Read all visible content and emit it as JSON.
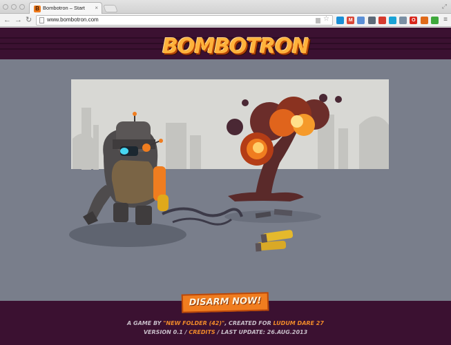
{
  "browser": {
    "tab_favicon_letter": "B",
    "tab_title": "Bombotron – Start",
    "tab_close": "×",
    "url": "www.bombotron.com",
    "nav_back": "←",
    "nav_forward": "→",
    "nav_reload": "↻",
    "star": "☆",
    "menu": "≡",
    "fullscreen": "⤢",
    "extensions": [
      {
        "name": "extension-blue-icon",
        "color": "#1a8fd6",
        "glyph": ""
      },
      {
        "name": "gmail-icon",
        "color": "#d94637",
        "glyph": "M"
      },
      {
        "name": "cloud-extension-icon",
        "color": "#5b8fd6",
        "glyph": ""
      },
      {
        "name": "clipboard-extension-icon",
        "color": "#5d6a78",
        "glyph": ""
      },
      {
        "name": "calendar-extension-icon",
        "color": "#d63a2e",
        "glyph": ""
      },
      {
        "name": "feather-extension-icon",
        "color": "#1aa3d6",
        "glyph": ""
      },
      {
        "name": "link-extension-icon",
        "color": "#7a8fa3",
        "glyph": ""
      },
      {
        "name": "opera-extension-icon",
        "color": "#d8261b",
        "glyph": "O"
      },
      {
        "name": "circle-extension-icon",
        "color": "#e06a1a",
        "glyph": ""
      },
      {
        "name": "evernote-extension-icon",
        "color": "#3fa83c",
        "glyph": ""
      }
    ]
  },
  "site": {
    "logo": "BOMBOTRON",
    "disarm_button": "DISARM NOW!",
    "credits": {
      "line1_prefix": "A GAME BY ",
      "team": "\"NEW FOLDER (42)\"",
      "line1_middle": ", CREATED FOR ",
      "event": "LUDUM DARE 27",
      "line2_prefix": "VERSION 0.1 / ",
      "credits_link": "CREDITS",
      "line2_suffix": " / LAST UPDATE: 26.AUG.2013"
    }
  },
  "colors": {
    "brand_orange": "#f07d1f",
    "header_purple": "#3b1131",
    "scene_gray": "#797e8b"
  }
}
